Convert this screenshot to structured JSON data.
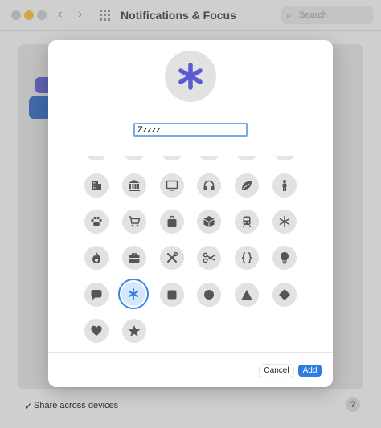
{
  "window": {
    "title": "Notifications & Focus",
    "search_placeholder": "Search",
    "share_label": "Share across devices",
    "help_label": "?"
  },
  "sheet": {
    "name_value": "Zzzzz",
    "selected_icon": "asterisk",
    "cancel_label": "Cancel",
    "add_label": "Add",
    "accent_color": "#5b5bd6",
    "selection_color": "#2f7de1",
    "icons": [
      "building-icon",
      "bank-icon",
      "monitor-icon",
      "headphones-icon",
      "leaf-icon",
      "person-icon",
      "paw-icon",
      "cart-icon",
      "shopping-bag-icon",
      "box-icon",
      "train-icon",
      "snowflake-icon",
      "flame-icon",
      "briefcase-icon",
      "tools-icon",
      "scissors-icon",
      "curly-braces-icon",
      "lightbulb-icon",
      "speech-bubble-icon",
      "asterisk-icon",
      "square-icon",
      "circle-icon",
      "triangle-icon",
      "diamond-icon",
      "heart-icon",
      "star-icon"
    ]
  }
}
